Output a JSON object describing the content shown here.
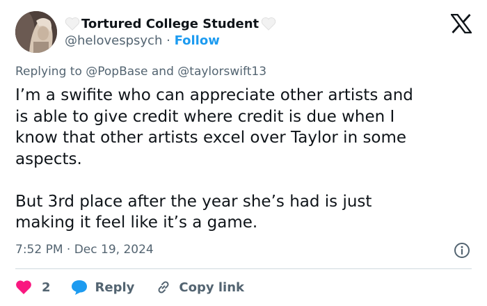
{
  "author": {
    "display_name": "Tortured College Student",
    "handle": "@helovespsych",
    "separator": "·",
    "follow_label": "Follow",
    "name_decoration": "white-heart-icon"
  },
  "platform_logo": "x-logo",
  "reply_context": {
    "prefix": "Replying to",
    "mention_1": "@PopBase",
    "conjunction": "and",
    "mention_2": "@taylorswift13"
  },
  "tweet": {
    "text": "I’m a swifite who can appreciate other artists and\nis able to give credit where credit is due when I\nknow that other artists excel over Taylor in some\naspects.\n\nBut 3rd place after the year she’s had is just\nmaking it feel like it’s a game.",
    "timestamp": "7:52 PM · Dec 19, 2024"
  },
  "actions": {
    "like_count": "2",
    "reply_label": "Reply",
    "copy_link_label": "Copy link"
  },
  "colors": {
    "like": "#f91880",
    "reply": "#1d9bf0",
    "link": "#1d9bf0",
    "secondary_text": "#536471",
    "primary_text": "#0f1419",
    "divider": "#cfd9de"
  }
}
